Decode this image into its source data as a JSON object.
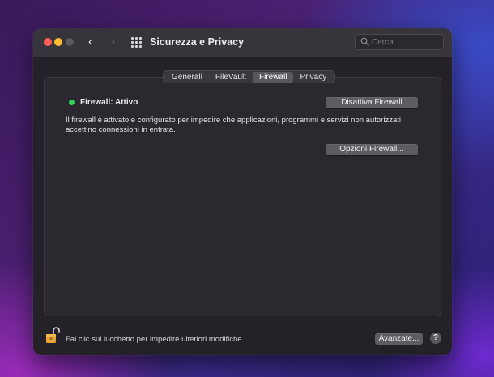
{
  "window": {
    "title": "Sicurezza e Privacy",
    "search": {
      "placeholder": "Cerca",
      "value": ""
    }
  },
  "tabs": [
    "Generali",
    "FileVault",
    "Firewall",
    "Privacy"
  ],
  "active_tab": "Firewall",
  "firewall": {
    "status": "Firewall: Attivo",
    "status_color": "#30d158",
    "disable_button": "Disattiva Firewall",
    "description": "Il firewall è attivato e configurato per impedire che applicazioni, programmi e servizi non autorizzati accettino connessioni in entrata.",
    "options_button": "Opzioni Firewall..."
  },
  "footer": {
    "lock_text": "Fai clic sul lucchetto per impedire ulteriori modifiche.",
    "advanced_button": "Avanzate...",
    "help_label": "?"
  },
  "icons": {
    "lock": "unlocked-padlock-icon",
    "grid": "show-all-grid-icon",
    "search": "magnifier-icon"
  }
}
